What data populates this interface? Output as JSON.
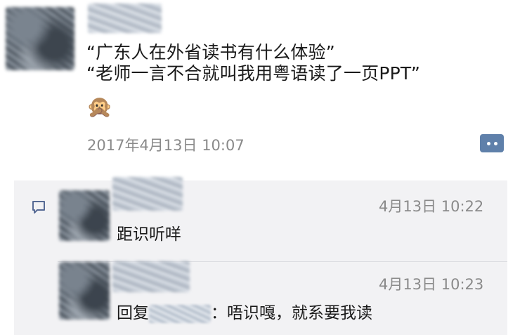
{
  "post": {
    "lines": [
      "“广东人在外省读书有什么体验”",
      "“老师一言不合就叫我用粤语读了一页PPT”"
    ],
    "emoji": "🙊",
    "time": "2017年4月13日 10:07"
  },
  "comments": [
    {
      "time": "4月13日 10:22",
      "text": "距识听咩"
    },
    {
      "time": "4月13日 10:23",
      "reply_label": "回复",
      "reply_tail": "：",
      "text": "唔识嘎，就系要我读"
    }
  ],
  "icons": {
    "more": "more-dots-icon",
    "comment": "comment-bubble-icon"
  },
  "colors": {
    "link": "#576b95",
    "more_button": "#5f80aa",
    "comment_bg": "#f2f2f4"
  }
}
